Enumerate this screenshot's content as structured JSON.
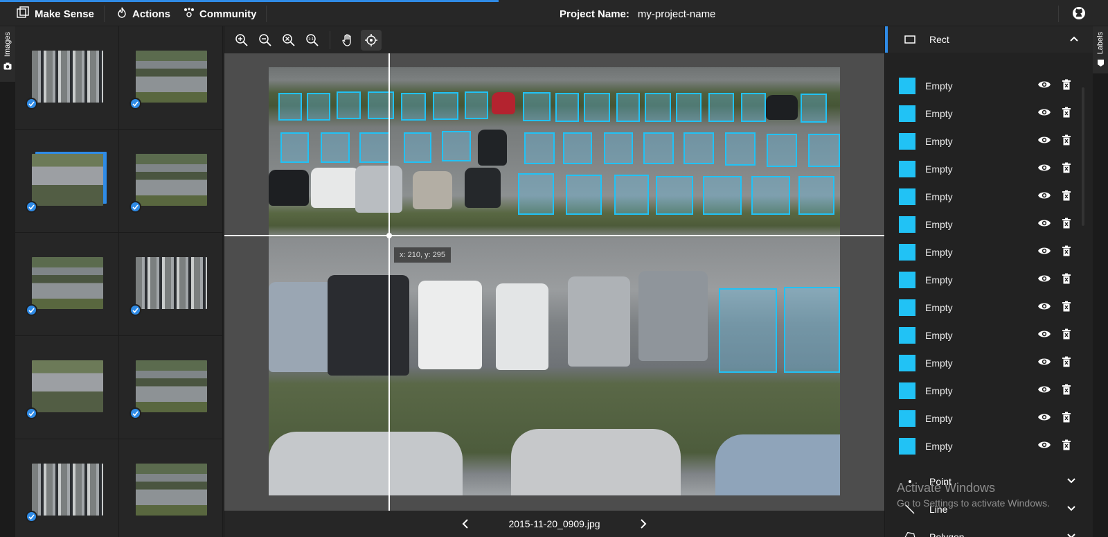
{
  "topbar": {
    "brand": "Make Sense",
    "menu": [
      {
        "label": "Actions",
        "icon": "fire-icon"
      },
      {
        "label": "Community",
        "icon": "community-icon"
      }
    ],
    "project_label": "Project Name:",
    "project_value": "my-project-name",
    "github_icon": "github-icon"
  },
  "left_tab": {
    "label": "Images",
    "icon": "camera-icon"
  },
  "right_tab": {
    "label": "Labels",
    "icon": "tag-icon"
  },
  "images": [
    {
      "checked": true,
      "selected": false
    },
    {
      "checked": true,
      "selected": false
    },
    {
      "checked": true,
      "selected": true
    },
    {
      "checked": true,
      "selected": false
    },
    {
      "checked": true,
      "selected": false
    },
    {
      "checked": true,
      "selected": false
    },
    {
      "checked": true,
      "selected": false
    },
    {
      "checked": true,
      "selected": false
    },
    {
      "checked": true,
      "selected": false
    },
    {
      "checked": true,
      "selected": false
    }
  ],
  "toolbar": {
    "buttons": [
      "zoom-in-icon",
      "zoom-out-icon",
      "zoom-fit-icon",
      "zoom-max-icon",
      "hand-icon",
      "crosshair-icon"
    ],
    "active": "crosshair-icon"
  },
  "editor": {
    "cursor_coords": "x: 210, y: 295",
    "accent_color": "#21c2f5"
  },
  "bottom_nav": {
    "filename": "2015-11-20_0909.jpg"
  },
  "labels_panel": {
    "rect": {
      "name": "Rect",
      "expanded": true
    },
    "items": [
      {
        "name": "Empty"
      },
      {
        "name": "Empty"
      },
      {
        "name": "Empty"
      },
      {
        "name": "Empty"
      },
      {
        "name": "Empty"
      },
      {
        "name": "Empty"
      },
      {
        "name": "Empty"
      },
      {
        "name": "Empty"
      },
      {
        "name": "Empty"
      },
      {
        "name": "Empty"
      },
      {
        "name": "Empty"
      },
      {
        "name": "Empty"
      },
      {
        "name": "Empty"
      },
      {
        "name": "Empty"
      }
    ],
    "point": {
      "name": "Point"
    },
    "line": {
      "name": "Line"
    },
    "polygon": {
      "name": "Polygon"
    }
  },
  "watermark": {
    "title": "Activate Windows",
    "subtitle": "Go to Settings to activate Windows."
  }
}
